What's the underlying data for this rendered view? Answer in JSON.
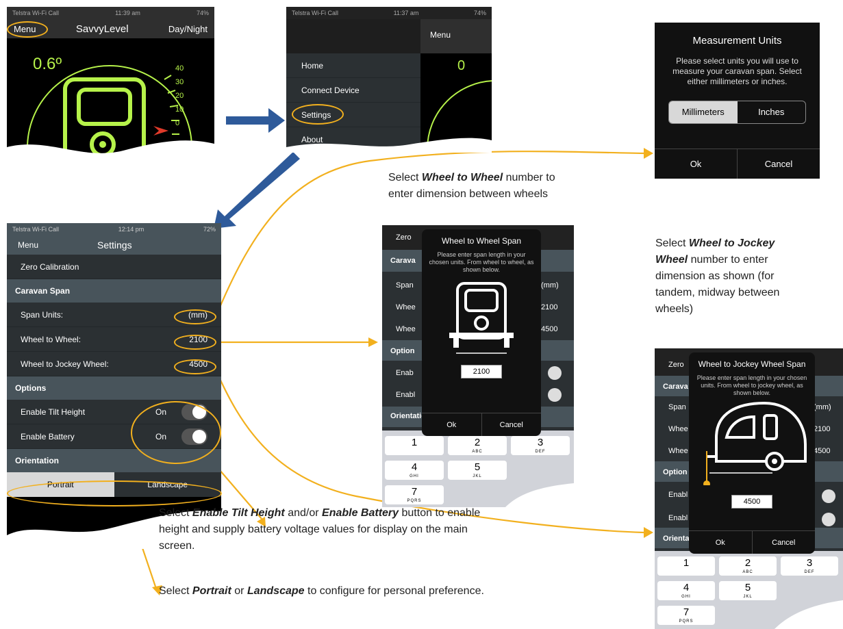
{
  "main": {
    "status_left": "Telstra Wi-Fi Call",
    "time": "11:39 am",
    "battery": "74%",
    "menu": "Menu",
    "title": "SavvyLevel",
    "daynight": "Day/Night",
    "angle": "0.6º",
    "ticks": [
      "40",
      "30",
      "20",
      "10",
      "0"
    ]
  },
  "menu_shot": {
    "status_left": "Telstra Wi-Fi Call",
    "time": "11:37 am",
    "battery": "74%",
    "menu": "Menu",
    "items": [
      "Home",
      "Connect Device",
      "Settings",
      "About"
    ],
    "bg_value": "0"
  },
  "units": {
    "title": "Measurement Units",
    "message": "Please select units you will use to measure your caravan span. Select either millimeters or inches.",
    "opt1": "Millimeters",
    "opt2": "Inches",
    "ok": "Ok",
    "cancel": "Cancel"
  },
  "settings": {
    "status_left": "Telstra Wi-Fi Call",
    "time": "12:14 pm",
    "battery": "72%",
    "menu": "Menu",
    "title": "Settings",
    "zero": "Zero Calibration",
    "caravan": "Caravan Span",
    "span_units": "Span Units:",
    "span_units_val": "(mm)",
    "w2w": "Wheel to Wheel:",
    "w2w_val": "2100",
    "w2j": "Wheel to Jockey Wheel:",
    "w2j_val": "4500",
    "options": "Options",
    "tilt": "Enable Tilt Height",
    "tilt_val": "On",
    "battery_opt": "Enable Battery",
    "battery_val": "On",
    "orientation": "Orientation",
    "portrait": "Portrait",
    "landscape": "Landscape"
  },
  "w2w_dialog": {
    "bg_zero": "Zero",
    "bg_cara": "Carava",
    "bg_span": "Span",
    "bg_whee": "Whee",
    "bg_whee2": "Whee",
    "bg_option": "Option",
    "bg_enab": "Enab",
    "bg_enab2": "Enabl",
    "bg_orient": "Orientation",
    "bg_mm": "(mm)",
    "bg_2100": "2100",
    "bg_4500": "4500",
    "title": "Wheel to Wheel Span",
    "message": "Please enter span length in your chosen units. From wheel to wheel, as shown below.",
    "value": "2100",
    "ok": "Ok",
    "cancel": "Cancel"
  },
  "w2j_dialog": {
    "bg_zero": "Zero",
    "bg_cara": "Carava",
    "bg_span": "Span",
    "bg_whee": "Whee",
    "bg_whee2": "Whee",
    "bg_option": "Option",
    "bg_enab": "Enabl",
    "bg_enab2": "Enabl",
    "bg_orient": "Orientation",
    "bg_mm": "(mm)",
    "bg_2100": "2100",
    "bg_4500": "4500",
    "title": "Wheel to Jockey Wheel Span",
    "message": "Please enter span length in your chosen units. From wheel to jockey wheel, as shown below.",
    "value": "4500",
    "ok": "Ok",
    "cancel": "Cancel"
  },
  "keypad": {
    "k1": "1",
    "k2": "2",
    "k2s": "ABC",
    "k3": "3",
    "k3s": "DEF",
    "k4": "4",
    "k4s": "GHI",
    "k5": "5",
    "k5s": "JKL",
    "k7": "7",
    "k7s": "PQRS"
  },
  "captions": {
    "c1_pre": "Select ",
    "c1_b": "Wheel to Wheel",
    "c1_post": " number to",
    "c1_l2": "enter dimension between wheels",
    "c2_pre": "Select ",
    "c2_b1": "Wheel to Jockey",
    "c2_b2": "Wheel",
    "c2_post": " number to enter",
    "c2_l3": "dimension as shown (for",
    "c2_l4": "tandem, midway between",
    "c2_l5": "wheels)",
    "c3_pre": "Select ",
    "c3_b1": "Enable Tilt Height",
    "c3_mid": " and/or ",
    "c3_b2": "Enable Battery",
    "c3_post": " button to enable",
    "c3_l2": "height and supply battery voltage values for display on the main",
    "c3_l3": "screen.",
    "c4_pre": "Select ",
    "c4_b1": "Portrait",
    "c4_mid": " or ",
    "c4_b2": "Landscape",
    "c4_post": " to configure for personal preference."
  },
  "colors": {
    "accent": "#f2b01e",
    "arrow": "#2e5a9a",
    "gauge": "#b6f24a"
  }
}
